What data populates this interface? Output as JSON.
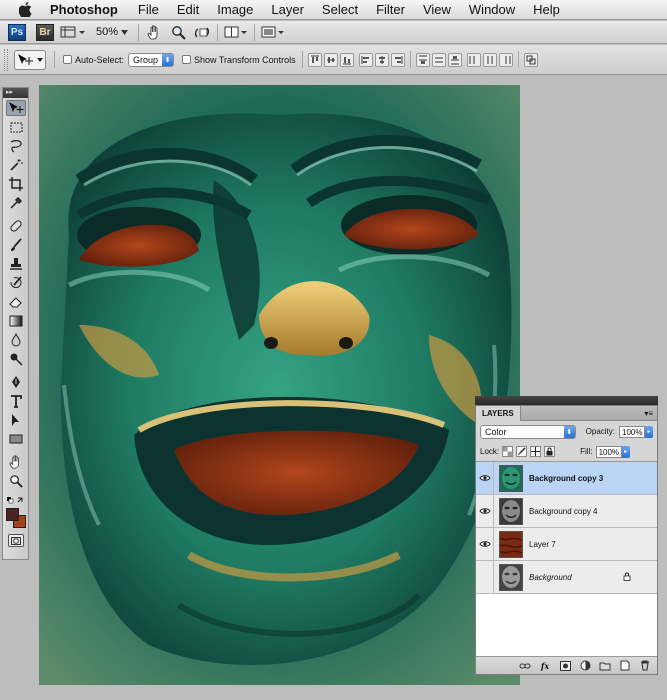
{
  "menubar": {
    "app_name": "Photoshop",
    "items": [
      "File",
      "Edit",
      "Image",
      "Layer",
      "Select",
      "Filter",
      "View",
      "Window",
      "Help"
    ]
  },
  "appbar": {
    "ps_label": "Ps",
    "br_label": "Br",
    "zoom": "50%"
  },
  "options": {
    "auto_select_label": "Auto-Select:",
    "auto_select_value": "Group",
    "show_transform_label": "Show Transform Controls"
  },
  "tools": {
    "header": "▸▸"
  },
  "layers_panel": {
    "tab": "LAYERS",
    "blend_mode": "Color",
    "opacity_label": "Opacity:",
    "opacity_value": "100%",
    "lock_label": "Lock:",
    "fill_label": "Fill:",
    "fill_value": "100%",
    "layers": [
      {
        "name": "Background copy 3",
        "visible": true,
        "selected": true
      },
      {
        "name": "Background copy 4",
        "visible": true,
        "selected": false
      },
      {
        "name": "Layer 7",
        "visible": true,
        "selected": false
      },
      {
        "name": "Background",
        "visible": false,
        "selected": false,
        "locked": true
      }
    ]
  },
  "colors": {
    "foreground": "#4a2520",
    "background": "#a8421a",
    "selection": "#b9d4f5"
  }
}
